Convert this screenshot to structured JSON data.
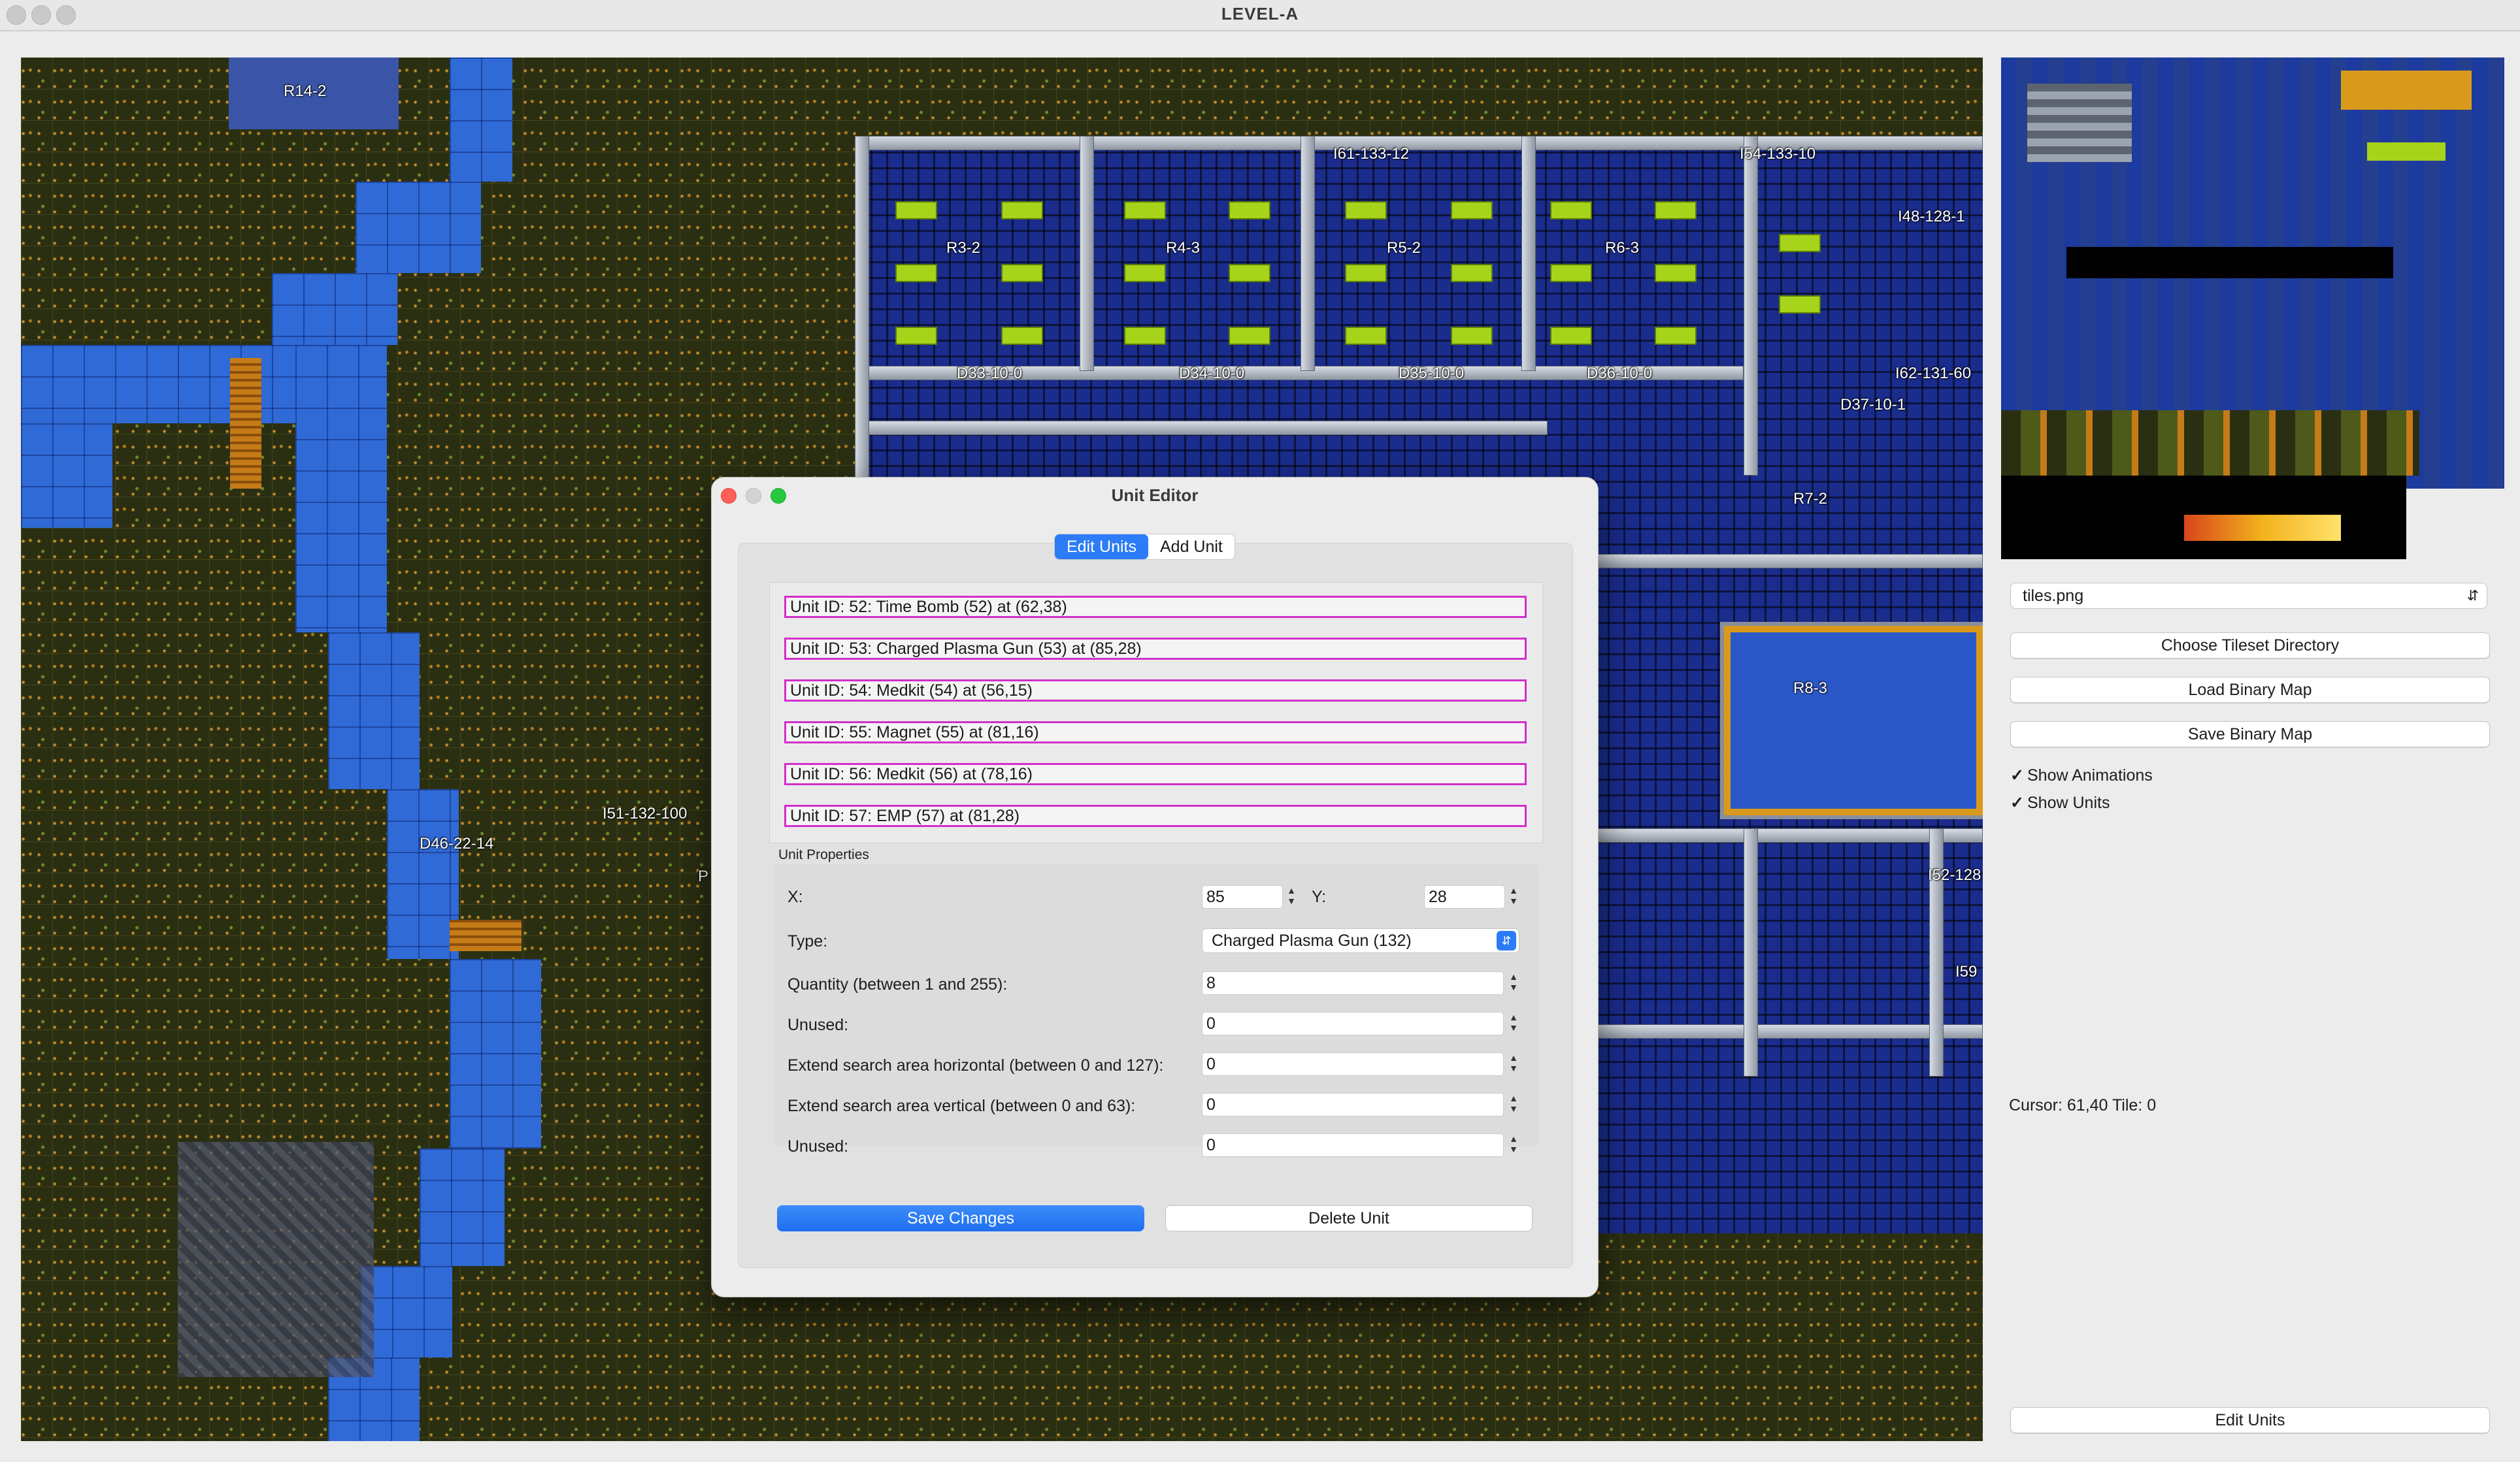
{
  "window": {
    "title": "LEVEL-A"
  },
  "map": {
    "labels": [
      "R14-2",
      "R3-2",
      "R4-3",
      "R5-2",
      "R6-3",
      "R7-2",
      "R8-3",
      "I61-133-12",
      "I54-133-10",
      "I48-128-1",
      "I62-131-60",
      "I52-128",
      "I59",
      "D33-10-0",
      "D34-10-0",
      "D35-10-0",
      "D36-10-0",
      "D37-10-1",
      "D46-22-14",
      "I51-132-100",
      "P"
    ]
  },
  "sidebar": {
    "tileset_select": "tiles.png",
    "choose_tileset_label": "Choose Tileset Directory",
    "load_map_label": "Load Binary Map",
    "save_map_label": "Save Binary Map",
    "show_animations_label": "Show Animations",
    "show_animations_checked": true,
    "show_units_label": "Show Units",
    "show_units_checked": true,
    "cursor_info": "Cursor: 61,40 Tile: 0",
    "edit_units_label": "Edit Units"
  },
  "unit_editor": {
    "title": "Unit Editor",
    "tabs": [
      "Edit Units",
      "Add Unit"
    ],
    "active_tab": "Edit Units",
    "units": [
      "Unit ID: 52: Time Bomb (52) at (62,38)",
      "Unit ID: 53: Charged Plasma Gun (53) at (85,28)",
      "Unit ID: 54: Medkit (54) at (56,15)",
      "Unit ID: 55: Magnet (55) at (81,16)",
      "Unit ID: 56: Medkit (56) at (78,16)",
      "Unit ID: 57: EMP (57) at (81,28)"
    ],
    "properties_label": "Unit Properties",
    "x_label": "X:",
    "x_value": "85",
    "y_label": "Y:",
    "y_value": "28",
    "type_label": "Type:",
    "type_value": "Charged Plasma Gun (132)",
    "quantity_label": "Quantity (between 1 and 255):",
    "quantity_value": "8",
    "unused1_label": "Unused:",
    "unused1_value": "0",
    "extend_h_label": "Extend search area horizontal (between 0 and 127):",
    "extend_h_value": "0",
    "extend_v_label": "Extend search area vertical (between 0 and 63):",
    "extend_v_value": "0",
    "unused2_label": "Unused:",
    "unused2_value": "0",
    "save_label": "Save Changes",
    "delete_label": "Delete Unit"
  },
  "colors": {
    "accent": "#2b7cf6",
    "unit_highlight": "#d22fcb",
    "water": "#2f6ad6",
    "floor": "#1a2c8c"
  }
}
